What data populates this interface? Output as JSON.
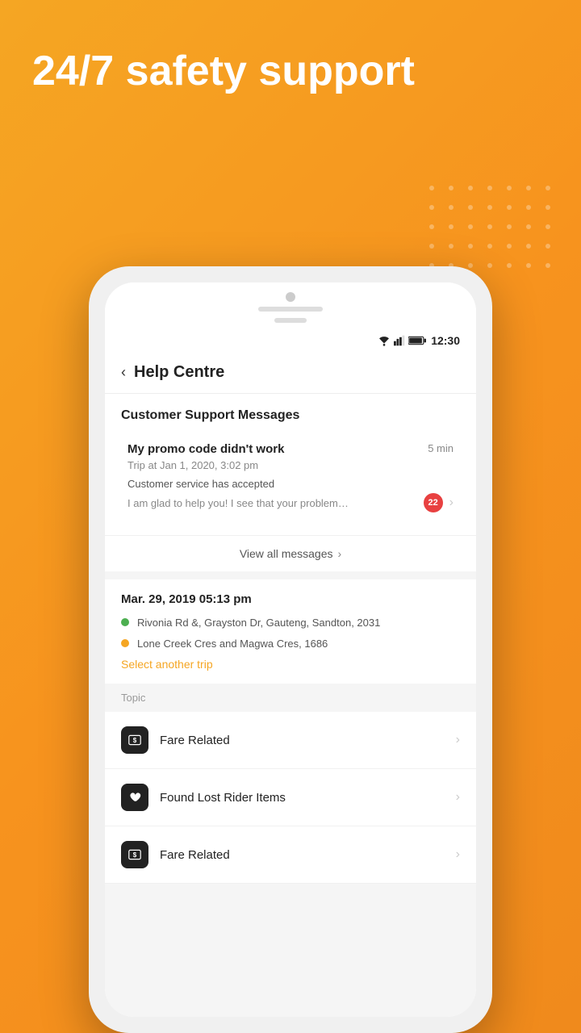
{
  "background": {
    "color": "#F5A623"
  },
  "hero": {
    "title": "24/7 safety support"
  },
  "phone": {
    "status_bar": {
      "time": "12:30"
    },
    "header": {
      "back_label": "‹",
      "title": "Help Centre"
    },
    "customer_support": {
      "section_title": "Customer Support Messages",
      "message": {
        "title": "My promo code didn't work",
        "time": "5 min",
        "trip": "Trip at Jan 1, 2020, 3:02 pm",
        "agent": "Customer service has accepted",
        "preview": "I am glad to help you! I see that your problem…",
        "badge_count": "22"
      },
      "view_all": "View all messages"
    },
    "trip": {
      "date": "Mar. 29, 2019  05:13 pm",
      "pickup": "Rivonia Rd &, Grayston Dr, Gauteng, Sandton, 2031",
      "dropoff": "Lone Creek Cres and Magwa Cres, 1686",
      "select_trip": "Select another trip"
    },
    "topics": {
      "header": "Topic",
      "items": [
        {
          "icon": "$",
          "label": "Fare Related",
          "icon_type": "dollar"
        },
        {
          "icon": "♥",
          "label": "Found Lost Rider Items",
          "icon_type": "heart"
        },
        {
          "icon": "$",
          "label": "Fare Related",
          "icon_type": "dollar"
        }
      ]
    }
  }
}
